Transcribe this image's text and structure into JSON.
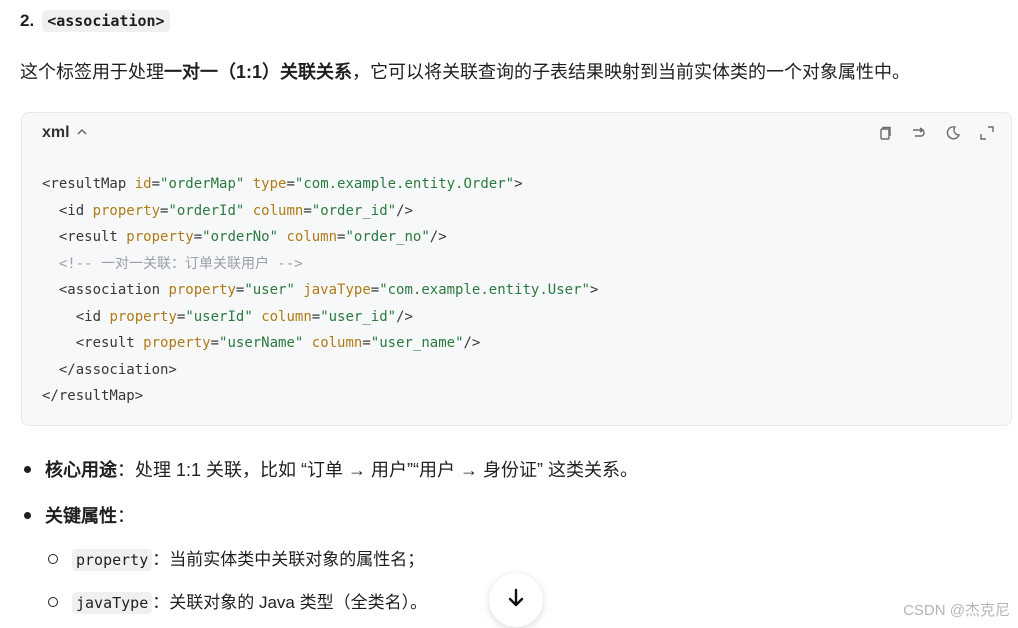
{
  "section": {
    "number": "2.",
    "tag": "<association>"
  },
  "intro": {
    "pre": "这个标签用于处理",
    "bold": "一对一（1:1）关联关系",
    "post": "，它可以将关联查询的子表结果映射到当前实体类的一个对象属性中。"
  },
  "code": {
    "lang": "xml",
    "collapse_icon": "chevron-up-icon",
    "tools": [
      "copy-icon",
      "wrap-icon",
      "theme-icon",
      "expand-icon"
    ],
    "lines": {
      "l1": {
        "a": "<resultMap ",
        "b": "id",
        "c": "=",
        "d": "\"orderMap\"",
        "e": " ",
        "f": "type",
        "g": "=",
        "h": "\"com.example.entity.Order\"",
        "i": ">"
      },
      "l2": {
        "a": "  <id ",
        "b": "property",
        "c": "=",
        "d": "\"orderId\"",
        "e": " ",
        "f": "column",
        "g": "=",
        "h": "\"order_id\"",
        "i": "/>"
      },
      "l3": {
        "a": "  <result ",
        "b": "property",
        "c": "=",
        "d": "\"orderNo\"",
        "e": " ",
        "f": "column",
        "g": "=",
        "h": "\"order_no\"",
        "i": "/>"
      },
      "l4": {
        "comment": "  <!-- 一对一关联：订单关联用户 -->"
      },
      "l5": {
        "a": "  <association ",
        "b": "property",
        "c": "=",
        "d": "\"user\"",
        "e": " ",
        "f": "javaType",
        "g": "=",
        "h": "\"com.example.entity.User\"",
        "i": ">"
      },
      "l6": {
        "a": "    <id ",
        "b": "property",
        "c": "=",
        "d": "\"userId\"",
        "e": " ",
        "f": "column",
        "g": "=",
        "h": "\"user_id\"",
        "i": "/>"
      },
      "l7": {
        "a": "    <result ",
        "b": "property",
        "c": "=",
        "d": "\"userName\"",
        "e": " ",
        "f": "column",
        "g": "=",
        "h": "\"user_name\"",
        "i": "/>"
      },
      "l8": {
        "text": "  </association>"
      },
      "l9": {
        "text": "</resultMap>"
      }
    }
  },
  "bullets": {
    "b1": {
      "bold": "核心用途",
      "text": "：处理 1:1 关联，比如 “订单 → 用户”“用户 → 身份证” 这类关系。"
    },
    "b2": {
      "bold": "关键属性",
      "text": "："
    }
  },
  "subs": {
    "s1": {
      "code": "property",
      "text": "：当前实体类中关联对象的属性名；"
    },
    "s2": {
      "code": "javaType",
      "text": "：关联对象的 Java 类型（全类名）。"
    }
  },
  "scroll_icon": "arrow-down-icon",
  "watermark": "CSDN @杰克尼"
}
